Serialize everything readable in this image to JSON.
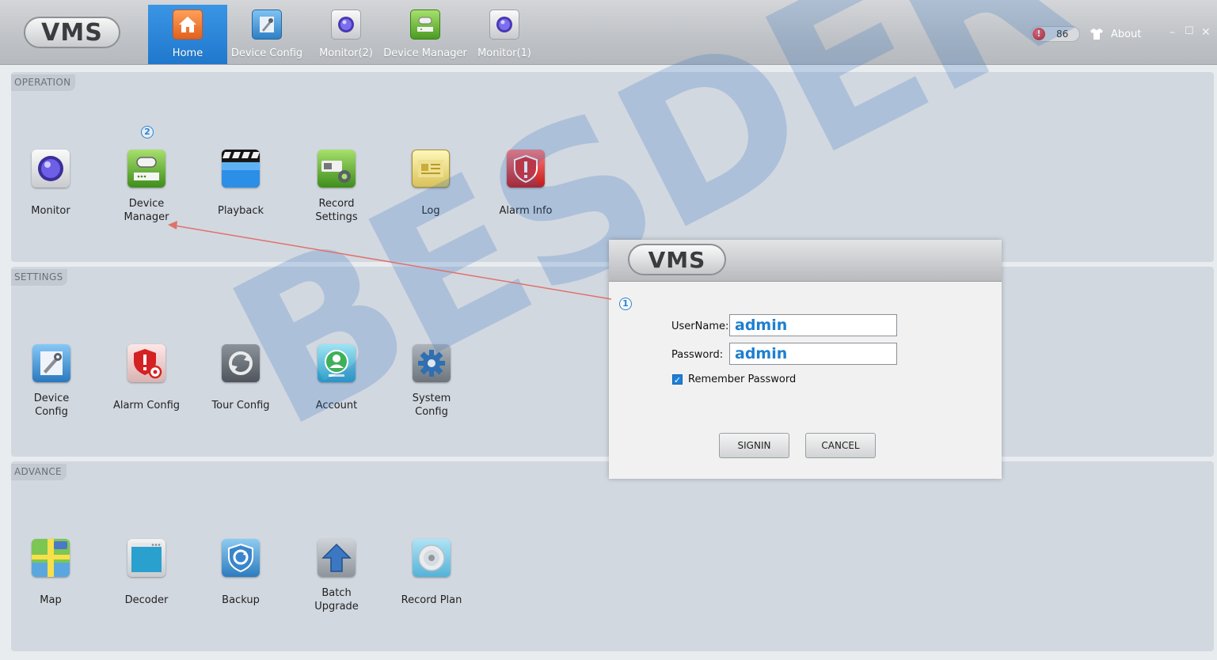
{
  "app": {
    "logo_text": "VMS",
    "about_label": "About",
    "alarm_count": "86",
    "alarm_glyph": "!",
    "window_controls": {
      "minimize": "–",
      "maximize": "☐",
      "close": "✕"
    }
  },
  "nav": {
    "tabs": [
      {
        "label": "Home",
        "icon": "home-icon",
        "active": true
      },
      {
        "label": "Device Config",
        "icon": "device-config-icon",
        "active": false
      },
      {
        "label": "Monitor(2)",
        "icon": "camera-icon",
        "active": false
      },
      {
        "label": "Device Manager",
        "icon": "device-manager-icon",
        "active": false
      },
      {
        "label": "Monitor(1)",
        "icon": "camera-icon",
        "active": false
      }
    ]
  },
  "sections": {
    "operation": {
      "title": "OPERATION",
      "items": [
        {
          "label": "Monitor",
          "icon": "monitor-icon"
        },
        {
          "label": "Device\nManager",
          "icon": "device-manager-icon"
        },
        {
          "label": "Playback",
          "icon": "playback-icon"
        },
        {
          "label": "Record\nSettings",
          "icon": "record-settings-icon"
        },
        {
          "label": "Log",
          "icon": "log-icon"
        },
        {
          "label": "Alarm Info",
          "icon": "alarm-info-icon"
        }
      ]
    },
    "settings": {
      "title": "SETTINGS",
      "items": [
        {
          "label": "Device\nConfig",
          "icon": "device-config-icon"
        },
        {
          "label": "Alarm Config",
          "icon": "alarm-config-icon"
        },
        {
          "label": "Tour Config",
          "icon": "tour-config-icon"
        },
        {
          "label": "Account",
          "icon": "account-icon"
        },
        {
          "label": "System\nConfig",
          "icon": "system-config-icon"
        }
      ]
    },
    "advance": {
      "title": "ADVANCE",
      "items": [
        {
          "label": "Map",
          "icon": "map-icon"
        },
        {
          "label": "Decoder",
          "icon": "decoder-icon"
        },
        {
          "label": "Backup",
          "icon": "backup-icon"
        },
        {
          "label": "Batch\nUpgrade",
          "icon": "batch-upgrade-icon"
        },
        {
          "label": "Record Plan",
          "icon": "record-plan-icon"
        }
      ]
    }
  },
  "login": {
    "logo_text": "VMS",
    "username_label": "UserName:",
    "username_value": "admin",
    "password_label": "Password:",
    "password_value": "admin",
    "remember_label": "Remember Password",
    "remember_checked": true,
    "signin_label": "SIGNIN",
    "cancel_label": "CANCEL"
  },
  "annotations": {
    "step1": "1",
    "step2": "2",
    "arrow_color": "#e0716b"
  },
  "watermark": "BESDER",
  "colors": {
    "accent": "#2a88dd",
    "input_text": "#1d7fd1",
    "panel": "#d2d8e0"
  }
}
